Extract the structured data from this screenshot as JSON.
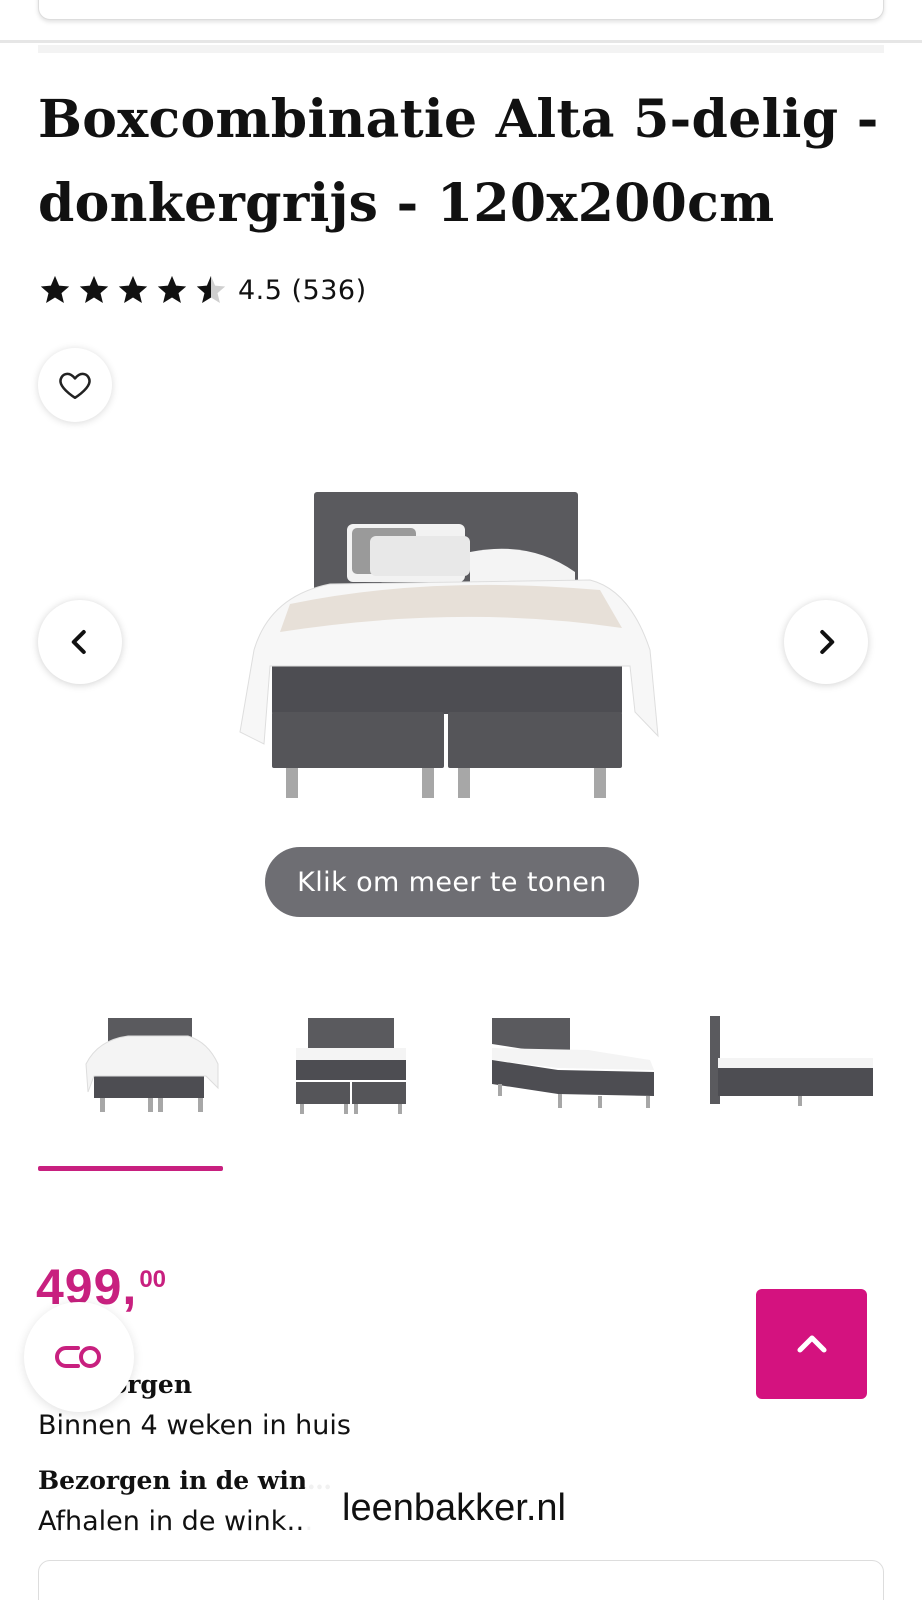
{
  "product": {
    "title_line1": "Boxcombinatie Alta 5-delig -",
    "title_line2": "donkergrijs - 120x200cm",
    "rating": {
      "value": 4.5,
      "max": 5,
      "label": "4.5 (536)"
    }
  },
  "gallery": {
    "more_label": "Klik om meer te tonen",
    "thumbnail_count": 4,
    "selected_index": 0
  },
  "pricing": {
    "price_main": "499,",
    "price_cents": "00"
  },
  "delivery": {
    "option1_title": "…bezorgen",
    "option1_text": "Binnen 4 weken in huis",
    "option2_title": "Bezorgen in de win…",
    "option2_text": "Afhalen in de wink…"
  },
  "browser": {
    "url": "leenbakker.nl"
  },
  "colors": {
    "brand": "#c8207f",
    "back_to_top": "#d4127f",
    "pill": "#6e6e73"
  },
  "icons": {
    "favorite": "heart-icon",
    "prev": "chevron-left-icon",
    "next": "chevron-right-icon",
    "chat": "chat-icon",
    "back_to_top": "chevron-up-icon"
  }
}
